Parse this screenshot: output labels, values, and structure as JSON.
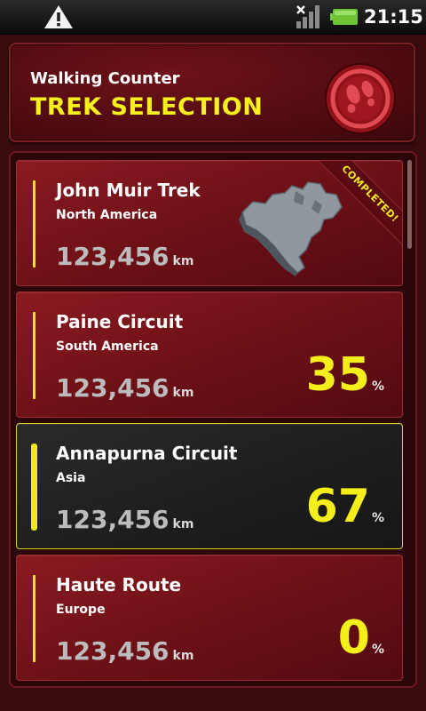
{
  "status_bar": {
    "time": "21:15",
    "icons": [
      "warning-icon",
      "signal-icon",
      "battery-icon"
    ]
  },
  "header": {
    "app_name": "Walking Counter",
    "title": "TREK SELECTION",
    "logo": "footprints-logo-icon"
  },
  "treks": [
    {
      "name": "John Muir Trek",
      "region": "North America",
      "distance": "123,456",
      "distance_unit": "km",
      "badge": "COMPLETED!",
      "map": "north-america-map-icon"
    },
    {
      "name": "Paine Circuit",
      "region": "South America",
      "distance": "123,456",
      "distance_unit": "km",
      "progress": "35",
      "progress_unit": "%"
    },
    {
      "name": "Annapurna Circuit",
      "region": "Asia",
      "distance": "123,456",
      "distance_unit": "km",
      "progress": "67",
      "progress_unit": "%",
      "selected": true
    },
    {
      "name": "Haute Route",
      "region": "Europe",
      "distance": "123,456",
      "distance_unit": "km",
      "progress": "0",
      "progress_unit": "%"
    }
  ],
  "colors": {
    "accent_yellow": "#f4ee1b",
    "card_red": "#7a141b",
    "selected_dark": "#1f1f1f",
    "background": "#3a0c0f"
  }
}
